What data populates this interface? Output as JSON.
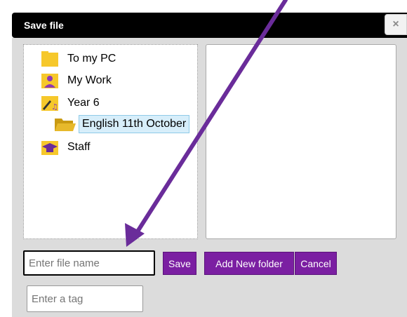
{
  "dialog": {
    "title": "Save file",
    "close_label": "×"
  },
  "tree": {
    "items": [
      {
        "label": "To my PC",
        "icon": "folder-icon"
      },
      {
        "label": "My Work",
        "icon": "user-folder-icon"
      },
      {
        "label": "Year 6",
        "icon": "music-folder-icon"
      },
      {
        "label": "English 11th October",
        "icon": "open-folder-icon",
        "selected": true
      },
      {
        "label": "Staff",
        "icon": "graduation-cap-folder-icon"
      }
    ]
  },
  "form": {
    "filename_placeholder": "Enter file name",
    "filename_value": "",
    "tag_placeholder": "Enter a tag",
    "tag_value": ""
  },
  "buttons": {
    "save": "Save",
    "add_folder": "Add New folder",
    "cancel": "Cancel"
  },
  "colors": {
    "accent": "#7b1fa2",
    "annotation_arrow": "#6a2c9a",
    "folder": "#f6c82b",
    "selected_bg": "#d7eefa"
  }
}
